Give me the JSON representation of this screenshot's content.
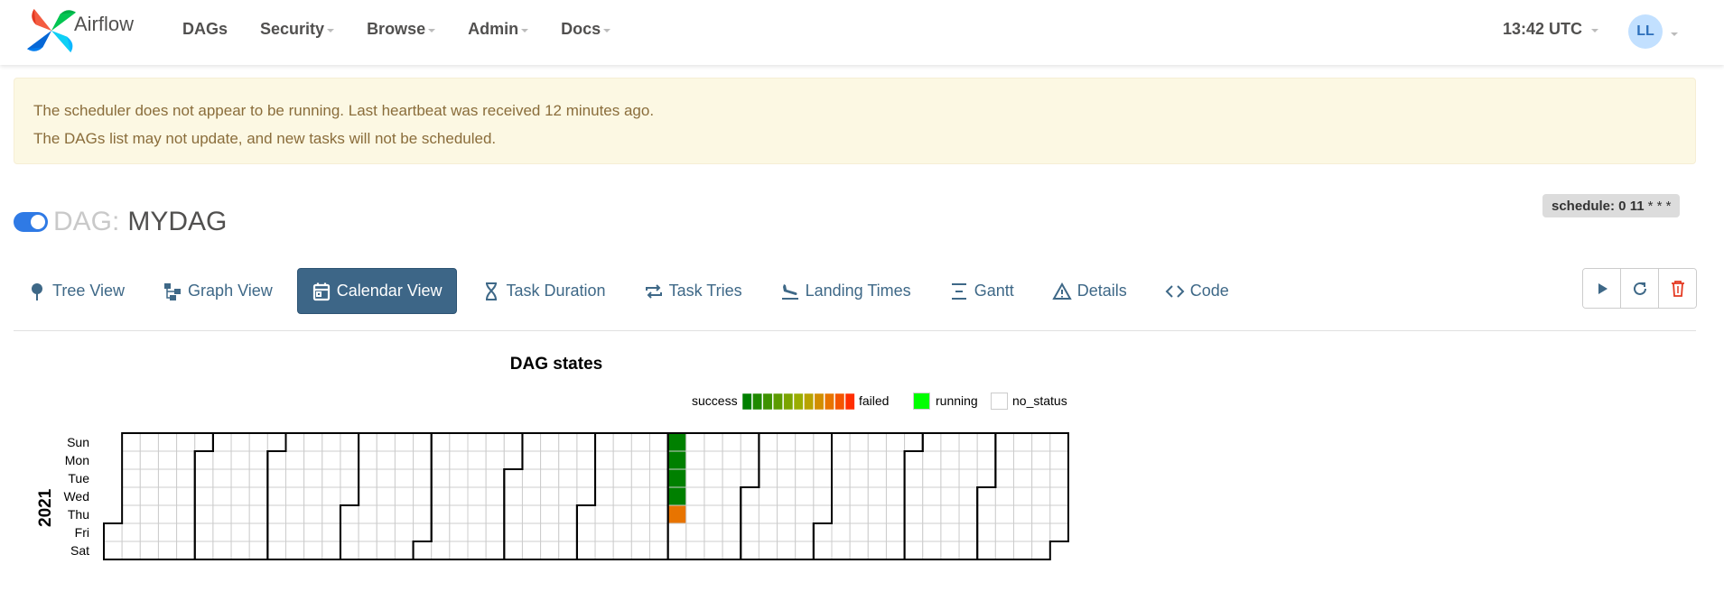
{
  "brand": {
    "name": "Airflow",
    "logo_icon": "airflow-pinwheel-icon"
  },
  "nav": {
    "items": [
      {
        "label": "DAGs",
        "dropdown": false
      },
      {
        "label": "Security",
        "dropdown": true
      },
      {
        "label": "Browse",
        "dropdown": true
      },
      {
        "label": "Admin",
        "dropdown": true
      },
      {
        "label": "Docs",
        "dropdown": true
      }
    ],
    "clock": "13:42 UTC",
    "user_initials": "LL"
  },
  "alert": {
    "line1": "The scheduler does not appear to be running. Last heartbeat was received 12 minutes ago.",
    "line2": "The DAGs list may not update, and new tasks will not be scheduled."
  },
  "dag": {
    "label": "DAG:",
    "name": "MYDAG",
    "paused": false,
    "schedule_label": "schedule: 0 11",
    "schedule_rest": "* * *"
  },
  "tabs": [
    {
      "label": "Tree View",
      "icon": "tree-view-icon",
      "active": false
    },
    {
      "label": "Graph View",
      "icon": "graph-view-icon",
      "active": false
    },
    {
      "label": "Calendar View",
      "icon": "calendar-icon",
      "active": true
    },
    {
      "label": "Task Duration",
      "icon": "hourglass-icon",
      "active": false
    },
    {
      "label": "Task Tries",
      "icon": "repeat-icon",
      "active": false
    },
    {
      "label": "Landing Times",
      "icon": "plane-landing-icon",
      "active": false
    },
    {
      "label": "Gantt",
      "icon": "gantt-icon",
      "active": false
    },
    {
      "label": "Details",
      "icon": "warning-triangle-icon",
      "active": false
    },
    {
      "label": "Code",
      "icon": "code-icon",
      "active": false
    }
  ],
  "actions": [
    {
      "name": "trigger-dag-button",
      "icon": "play-icon"
    },
    {
      "name": "refresh-button",
      "icon": "refresh-icon"
    },
    {
      "name": "delete-dag-button",
      "icon": "trash-icon"
    }
  ],
  "calendar": {
    "title": "DAG states",
    "year": "2021",
    "day_labels": [
      "Sun",
      "Mon",
      "Tue",
      "Wed",
      "Thu",
      "Fri",
      "Sat"
    ],
    "legend": {
      "success_label": "success",
      "failed_label": "failed",
      "running_label": "running",
      "no_status_label": "no_status",
      "gradient_colors": [
        "#008000",
        "#1f8900",
        "#3e9200",
        "#5c9b00",
        "#7ba400",
        "#9aad00",
        "#b8a300",
        "#d28e00",
        "#e87400",
        "#f45500",
        "#ff2e00"
      ],
      "running_color": "#00ff00",
      "no_status_color": "#ffffff"
    },
    "colors": {
      "success": "#008000",
      "partial_failed": "#e87400",
      "empty": "#ffffff",
      "grid": "#cccccc",
      "month_border": "#000000"
    },
    "runs": [
      {
        "date": "2021-08-01",
        "status": "success"
      },
      {
        "date": "2021-08-02",
        "status": "success"
      },
      {
        "date": "2021-08-03",
        "status": "success"
      },
      {
        "date": "2021-08-04",
        "status": "success"
      },
      {
        "date": "2021-08-05",
        "status": "failed_partial"
      }
    ]
  }
}
